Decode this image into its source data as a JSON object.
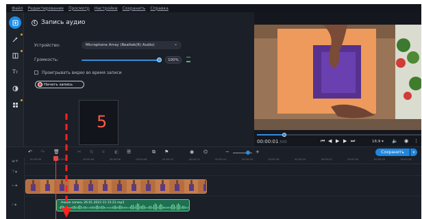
{
  "menu": [
    "Файл",
    "Редактирование",
    "Просмотр",
    "Настройки",
    "Сохранить",
    "Справка"
  ],
  "panel": {
    "title": "Запись аудио",
    "device_label": "Устройство:",
    "device_value": "Microphone Array (Realtek(R) Audio)",
    "volume_label": "Громкость:",
    "volume_value": "100%",
    "volume_level": 1.0,
    "checkbox_label": "Проигрывать видео во время записи",
    "record_button": "Начать запись",
    "overlay_number": "5"
  },
  "preview": {
    "time_current": "00:00:01",
    "time_fraction": ".500",
    "aspect_ratio": "16:9 ▾",
    "progress": 0.17
  },
  "timeline": {
    "save_button": "Сохранить",
    "ruler_ticks": [
      "00:00:00",
      "00:00:02",
      "00:00:04",
      "00:00:06",
      "00:00:08",
      "00:00:10",
      "00:00:12",
      "00:00:14",
      "00:00:16",
      "00:00:18",
      "00:00:20",
      "00:00:22",
      "00:00:24",
      "00:00:26",
      "00:00:28"
    ],
    "audio_clip_label": "Новая запись 26.01.2023 11:15:21.mp3"
  },
  "colors": {
    "accent": "#1e86e0",
    "record": "#e04848",
    "audio_clip": "#1f6f53",
    "video_clip": "#b46f43"
  },
  "icons": {
    "toolbar": [
      "import-icon",
      "magic-wand-icon",
      "filters-icon",
      "text-icon",
      "transitions-icon",
      "more-tools-icon"
    ]
  }
}
